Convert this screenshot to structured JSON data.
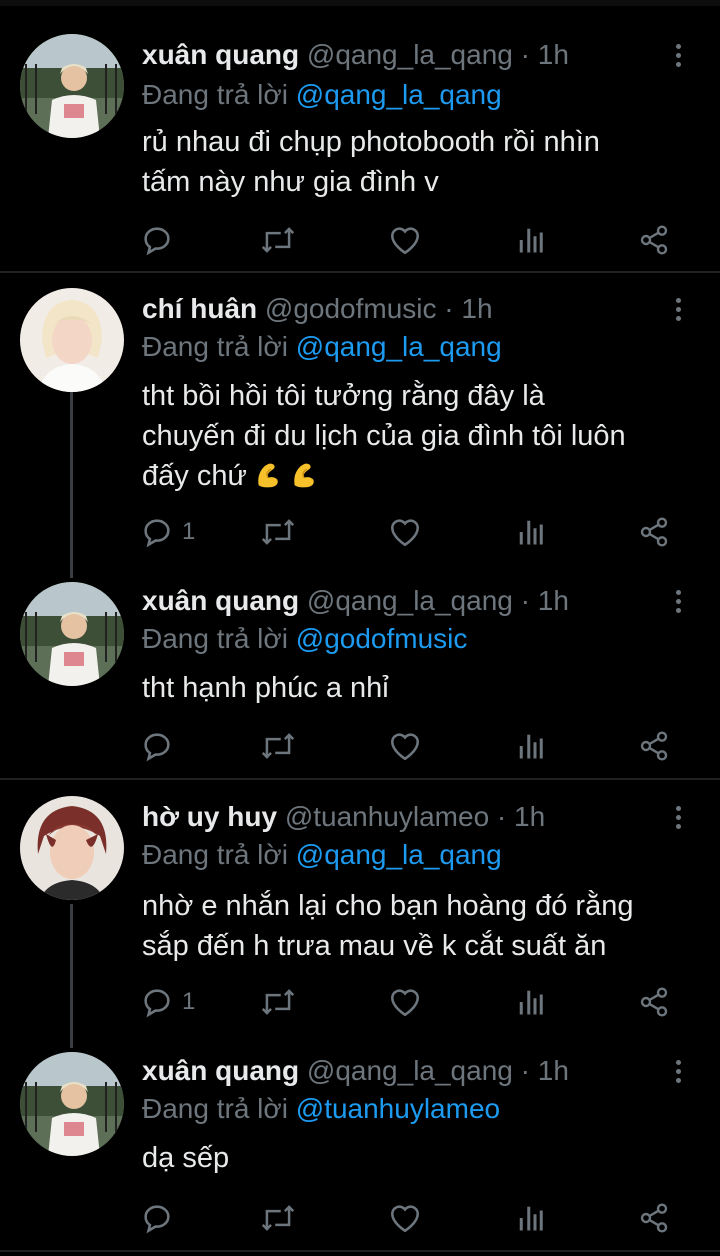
{
  "reply_prefix": "Đang trả lời",
  "tweets": [
    {
      "name": "xuân quang",
      "handle": "@qang_la_qang",
      "time": "1h",
      "reply_to": "@qang_la_qang",
      "text_lines": [
        "rủ nhau đi chụp photobooth rồi nhìn",
        "tấm này như gia đình v"
      ],
      "reply_count": "",
      "avatar": "avatar-xuan-quang"
    },
    {
      "name": "chí huân",
      "handle": "@godofmusic",
      "time": "1h",
      "reply_to": "@qang_la_qang",
      "text_lines": [
        "tht bồi hồi tôi tưởng rằng đây là",
        "chuyến đi du lịch của gia đình tôi luôn",
        "đấy chứ"
      ],
      "emoji": "pinching-hand-emoji",
      "reply_count": "1",
      "avatar": "avatar-chi-huan"
    },
    {
      "name": "xuân quang",
      "handle": "@qang_la_qang",
      "time": "1h",
      "reply_to": "@godofmusic",
      "text_lines": [
        "tht hạnh phúc a nhỉ"
      ],
      "reply_count": "",
      "avatar": "avatar-xuan-quang"
    },
    {
      "name": "hờ uy huy",
      "handle": "@tuanhuylameo",
      "time": "1h",
      "reply_to": "@qang_la_qang",
      "text_lines": [
        "nhờ e nhắn lại cho bạn hoàng đó rằng",
        "sắp đến h trưa mau về k cắt suất ăn"
      ],
      "reply_count": "1",
      "avatar": "avatar-ho-uy-huy"
    },
    {
      "name": "xuân quang",
      "handle": "@qang_la_qang",
      "time": "1h",
      "reply_to": "@tuanhuylameo",
      "text_lines": [
        "dạ sếp"
      ],
      "reply_count": "",
      "avatar": "avatar-xuan-quang"
    }
  ],
  "colors": {
    "background": "#000000",
    "text": "#e7e9ea",
    "muted": "#6e767d",
    "link": "#1d9bf0"
  },
  "icons": [
    "comment-icon",
    "retweet-icon",
    "like-icon",
    "analytics-icon",
    "share-icon",
    "more-icon"
  ]
}
